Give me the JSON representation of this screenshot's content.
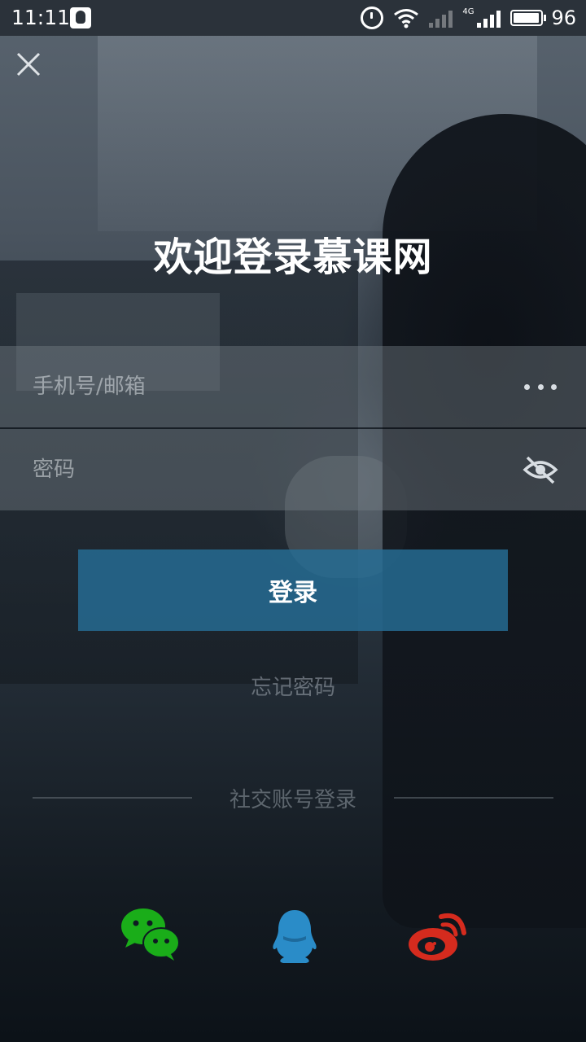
{
  "status_bar": {
    "time": "11:11",
    "network_type": "4G",
    "battery_level": "96"
  },
  "header": {
    "title": "欢迎登录慕课网"
  },
  "form": {
    "phone_placeholder": "手机号/邮箱",
    "password_placeholder": "密码",
    "login_label": "登录",
    "forgot_label": "忘记密码"
  },
  "social": {
    "label": "社交账号登录",
    "icons": [
      "wechat-icon",
      "qq-icon",
      "weibo-icon"
    ]
  },
  "colors": {
    "login_button": "#266E96",
    "wechat": "#1AAD19",
    "qq": "#2A8CC8",
    "weibo": "#D52B1E"
  }
}
